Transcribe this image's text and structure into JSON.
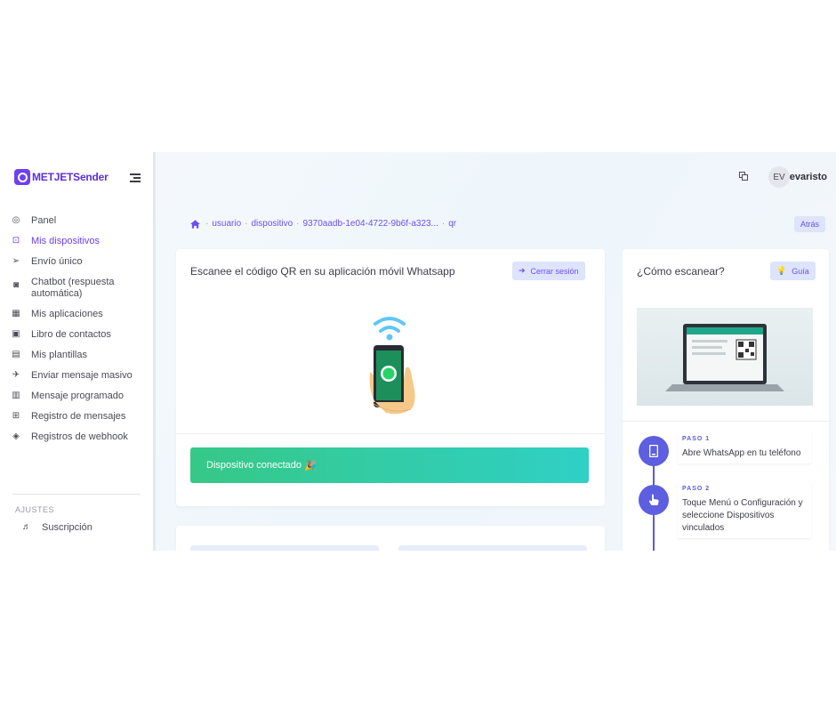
{
  "brand": {
    "name": "METJETSender"
  },
  "sidebar": {
    "items": [
      {
        "label": "Panel",
        "icon": "dashboard-icon",
        "active": false
      },
      {
        "label": "Mis dispositivos",
        "icon": "devices-icon",
        "active": true
      },
      {
        "label": "Envío único",
        "icon": "send-icon",
        "active": false
      },
      {
        "label": "Chatbot (respuesta automática)",
        "icon": "robot-icon",
        "active": false
      },
      {
        "label": "Mis aplicaciones",
        "icon": "apps-icon",
        "active": false
      },
      {
        "label": "Libro de contactos",
        "icon": "contacts-icon",
        "active": false
      },
      {
        "label": "Mis plantillas",
        "icon": "templates-icon",
        "active": false
      },
      {
        "label": "Enviar mensaje masivo",
        "icon": "rocket-icon",
        "active": false
      },
      {
        "label": "Mensaje programado",
        "icon": "calendar-icon",
        "active": false
      },
      {
        "label": "Registro de mensajes",
        "icon": "log-icon",
        "active": false
      },
      {
        "label": "Registros de webhook",
        "icon": "webhook-icon",
        "active": false
      }
    ],
    "settings_label": "AJUSTES",
    "settings_items": [
      {
        "label": "Suscripción",
        "icon": "subscription-icon"
      }
    ]
  },
  "topbar": {
    "avatar_initials": "EV",
    "username": "evaristo"
  },
  "breadcrumb": {
    "items": [
      "usuario",
      "dispositivo",
      "9370aadb-1e04-4722-9b6f-a323...",
      "qr"
    ],
    "separator": "·",
    "back_label": "Atrás"
  },
  "qr_card": {
    "title": "Escanee el código QR en su aplicación móvil Whatsapp",
    "logout_label": "Cerrar sesión",
    "status_text": "Dispositivo conectado",
    "status_emoji": "🎉"
  },
  "guide_card": {
    "title": "¿Cómo escanear?",
    "guide_label": "Guía",
    "steps": [
      {
        "tag": "PASO 1",
        "text": "Abre WhatsApp en tu teléfono",
        "icon": "phone-icon"
      },
      {
        "tag": "PASO 2",
        "text": "Toque Menú o Configuración y seleccione Dispositivos vinculados",
        "icon": "hand-pointer-icon"
      }
    ]
  },
  "colors": {
    "accent": "#6e3ff3",
    "link": "#6e4ef3",
    "status_gradient_start": "#36c887",
    "status_gradient_end": "#2fd0c6",
    "step_dot": "#5d5fe0"
  }
}
